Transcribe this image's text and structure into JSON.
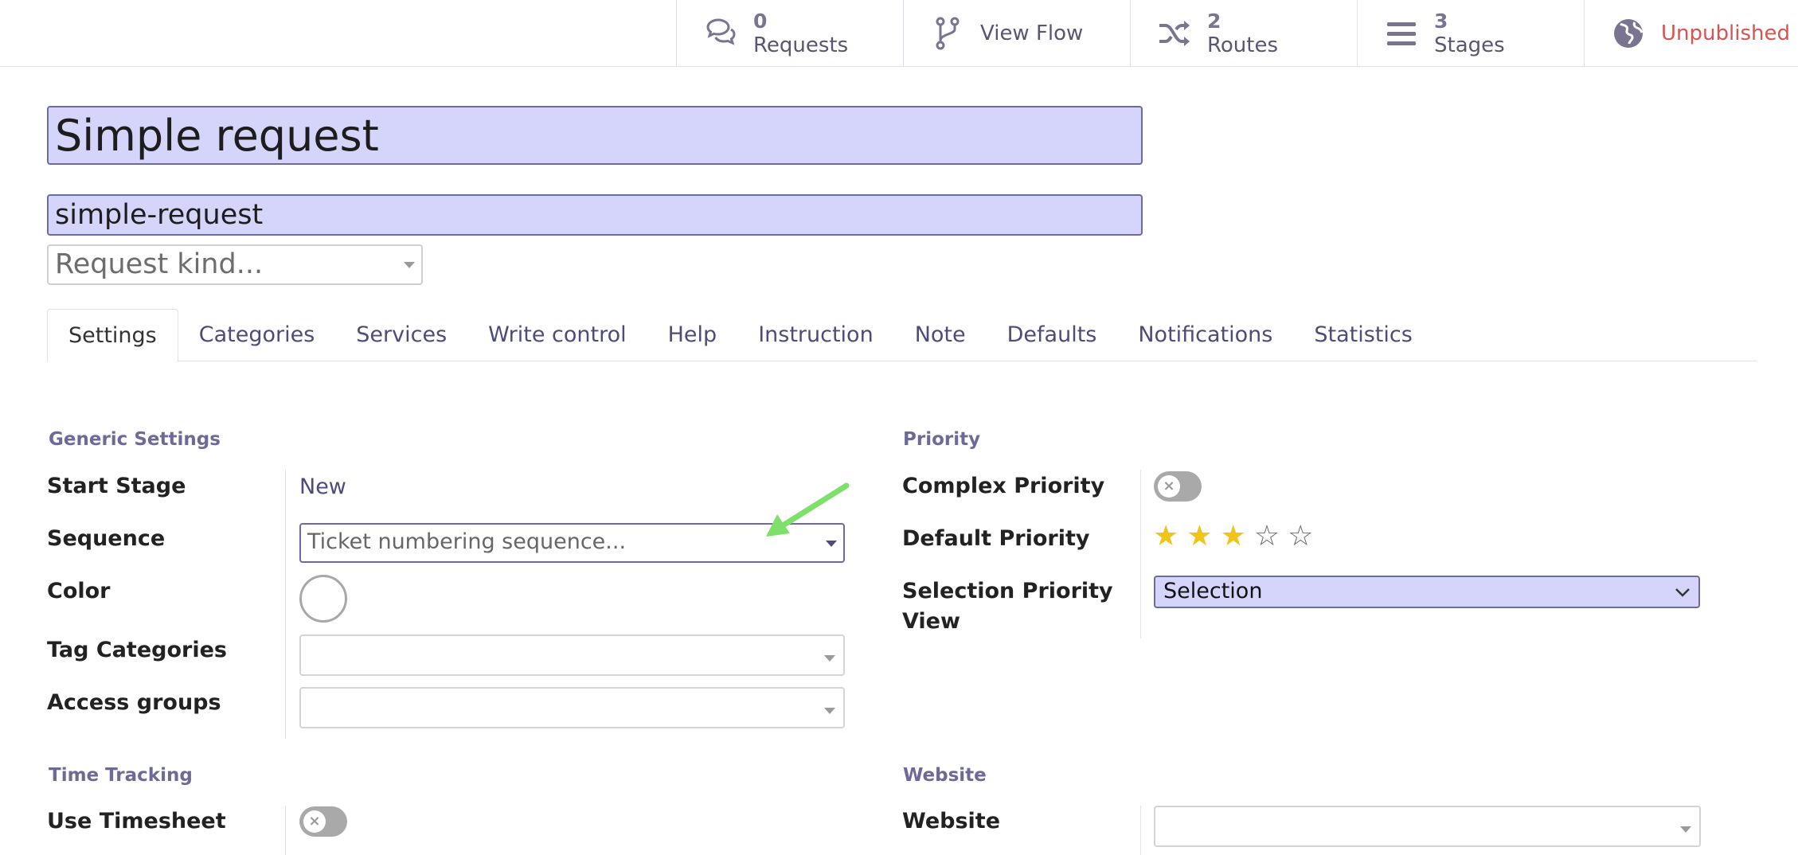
{
  "button_box": {
    "requests": {
      "value": "0",
      "label": "Requests"
    },
    "view_flow": {
      "label": "View Flow"
    },
    "routes": {
      "value": "2",
      "label": "Routes"
    },
    "stages": {
      "value": "3",
      "label": "Stages"
    },
    "publish": {
      "label": "Unpublished"
    }
  },
  "header": {
    "name": "Simple request",
    "code": "simple-request",
    "kind_placeholder": "Request kind..."
  },
  "tabs": [
    "Settings",
    "Categories",
    "Services",
    "Write control",
    "Help",
    "Instruction",
    "Note",
    "Defaults",
    "Notifications",
    "Statistics"
  ],
  "generic_settings": {
    "title": "Generic Settings",
    "start_stage": {
      "label": "Start Stage",
      "value": "New"
    },
    "sequence": {
      "label": "Sequence",
      "placeholder": "Ticket numbering sequence..."
    },
    "color": {
      "label": "Color"
    },
    "tag_categories": {
      "label": "Tag Categories"
    },
    "access_groups": {
      "label": "Access groups"
    }
  },
  "priority": {
    "title": "Priority",
    "complex_priority": {
      "label": "Complex Priority"
    },
    "default_priority": {
      "label": "Default Priority",
      "stars_filled": 3,
      "stars_total": 5
    },
    "selection_view": {
      "label_line1": "Selection Priority",
      "label_line2": "View",
      "value": "Selection"
    }
  },
  "time_tracking": {
    "title": "Time Tracking",
    "use_timesheet": {
      "label": "Use Timesheet"
    }
  },
  "website": {
    "title": "Website",
    "website": {
      "label": "Website"
    }
  },
  "colors": {
    "accent": "#6c6aa0",
    "field_fill": "#d5d4fa",
    "unpublished": "#d9534f",
    "star": "#f0c419",
    "arrow": "#7ee06a"
  }
}
